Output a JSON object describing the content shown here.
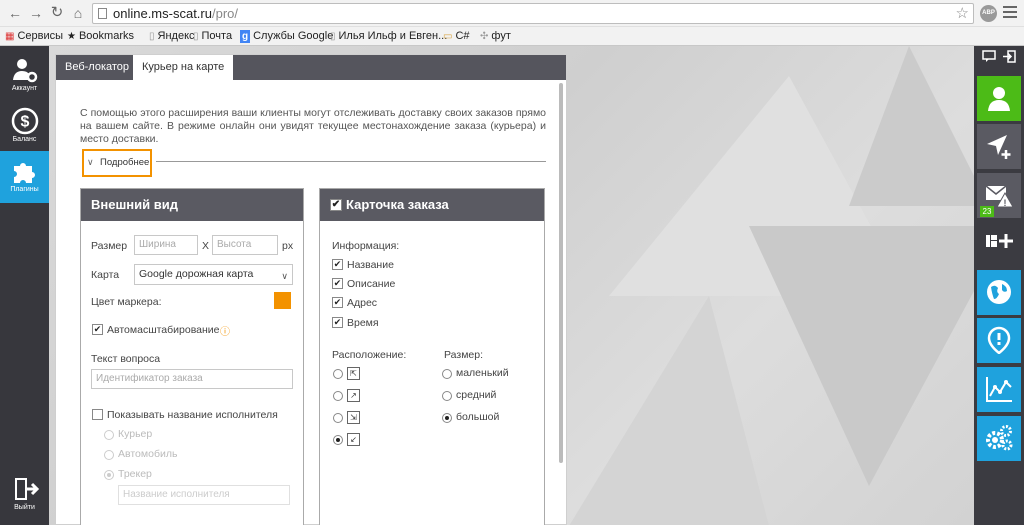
{
  "browser": {
    "url_host": "online.ms-scat.ru",
    "url_path": "/pro/",
    "abp_label": "ABP",
    "bookmarks": [
      {
        "label": "Сервисы",
        "icon": "apps-icon"
      },
      {
        "label": "Bookmarks",
        "icon": "star-icon"
      },
      {
        "label": "Яндекс",
        "icon": "page-icon"
      },
      {
        "label": "Почта",
        "icon": "page-icon"
      },
      {
        "label": "Службы Google",
        "icon": "google-icon"
      },
      {
        "label": "Илья Ильф и Евген...",
        "icon": "page-icon"
      },
      {
        "label": "C#",
        "icon": "folder-icon"
      },
      {
        "label": "фут",
        "icon": "page-icon"
      }
    ]
  },
  "left_sidebar": {
    "items": [
      {
        "label": "Аккаунт",
        "icon": "account-gear-icon"
      },
      {
        "label": "Баланс",
        "icon": "dollar-icon"
      },
      {
        "label": "Плагины",
        "icon": "puzzle-icon"
      }
    ],
    "exit_label": "Выйти"
  },
  "tabs": [
    {
      "label": "Веб-локатор"
    },
    {
      "label": "Курьер на карте"
    }
  ],
  "description": "С помощью этого расширения ваши клиенты могут отслеживать доставку своих заказов прямо на вашем сайте. В режиме онлайн они увидят текущее местонахождение заказа (курьера) и место доставки.",
  "more_label": "Подробнее",
  "appearance": {
    "title": "Внешний вид",
    "size_label": "Размер",
    "width_placeholder": "Ширина",
    "x_label": "X",
    "height_placeholder": "Высота",
    "px_label": "px",
    "map_label": "Карта",
    "map_value": "Google дорожная карта",
    "marker_color_label": "Цвет маркера:",
    "marker_color": "#f39200",
    "autoscale_label": "Автомасштабирование",
    "autoscale_checked": true,
    "question_label": "Текст вопроса",
    "question_placeholder": "Идентификатор заказа",
    "show_performer_label": "Показывать название исполнителя",
    "show_performer_checked": false,
    "performer_options": [
      "Курьер",
      "Автомобиль",
      "Трекер"
    ],
    "performer_name_placeholder": "Название исполнителя"
  },
  "order_card": {
    "title": "Карточка заказа",
    "title_checked": true,
    "info_label": "Информация:",
    "info_items": [
      {
        "label": "Название",
        "checked": true
      },
      {
        "label": "Описание",
        "checked": true
      },
      {
        "label": "Адрес",
        "checked": true
      },
      {
        "label": "Время",
        "checked": true
      }
    ],
    "position_label": "Расположение:",
    "positions_selected_index": 3,
    "size_label": "Размер:",
    "sizes": [
      {
        "label": "маленький",
        "selected": false
      },
      {
        "label": "средний",
        "selected": false
      },
      {
        "label": "большой",
        "selected": true
      }
    ]
  },
  "right_sidebar": {
    "notification_count": "23"
  },
  "colors": {
    "accent_blue": "#1fa2dd",
    "accent_green": "#4cbb17",
    "highlight_orange": "#f39200",
    "dark_panel": "#55555d"
  }
}
